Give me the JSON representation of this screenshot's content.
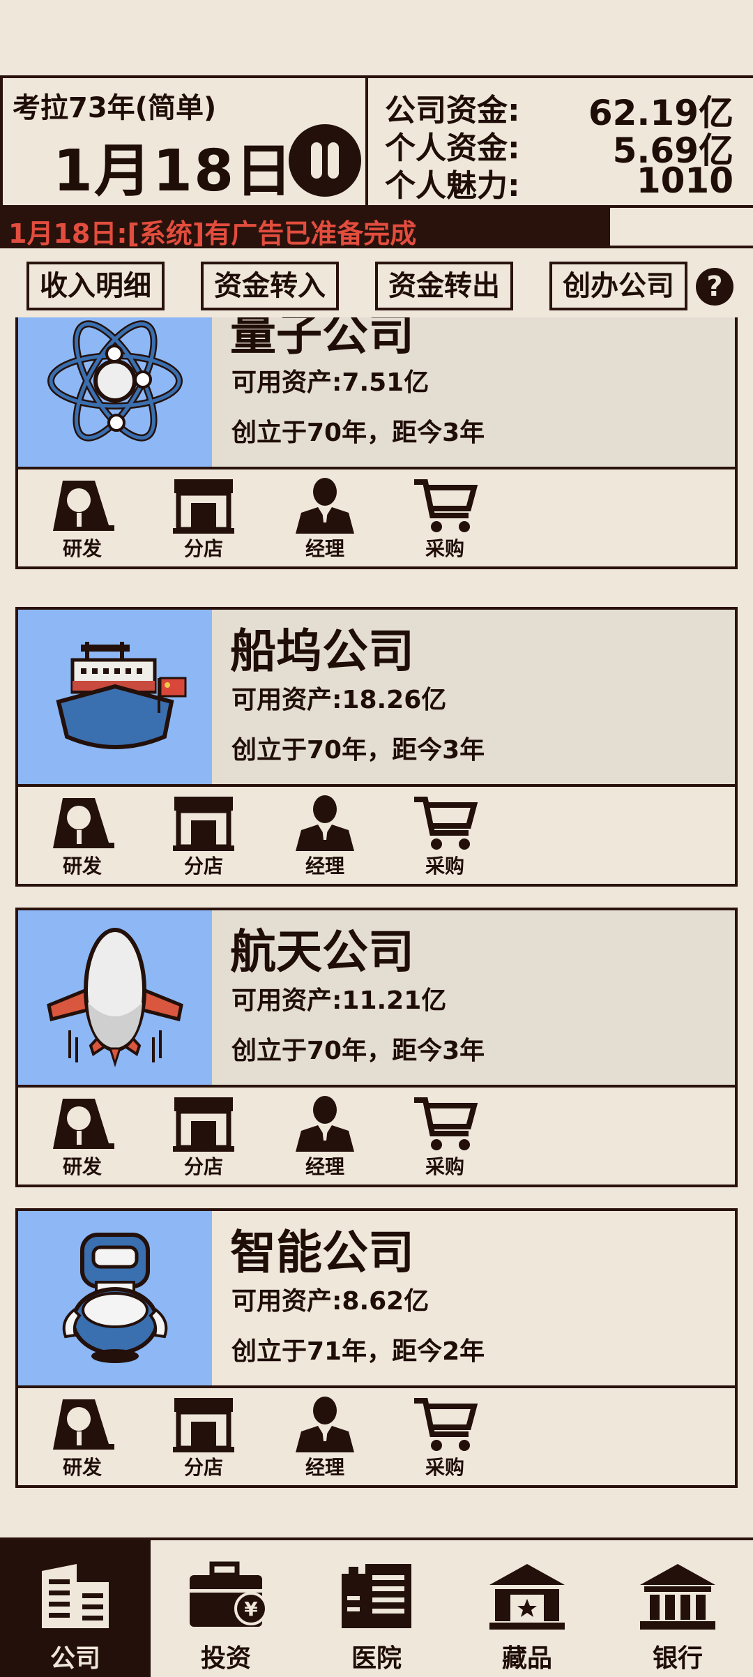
{
  "header": {
    "era": "考拉73年(简单)",
    "date": "1月18日",
    "finance": [
      {
        "label": "公司资金:",
        "value": "62.19亿"
      },
      {
        "label": "个人资金:",
        "value": "5.69亿"
      },
      {
        "label": "个人魅力:",
        "value": "1010"
      }
    ]
  },
  "ticker": "1月18日:[系统]有广告已准备完成",
  "actions": {
    "income_detail": "收入明细",
    "transfer_in": "资金转入",
    "transfer_out": "资金转出",
    "create_company": "创办公司",
    "help": "?"
  },
  "companies": [
    {
      "name": "量子公司",
      "assets": "可用资产:7.51亿",
      "founded": "创立于70年，距今3年",
      "icon": "atom-icon"
    },
    {
      "name": "船坞公司",
      "assets": "可用资产:18.26亿",
      "founded": "创立于70年，距今3年",
      "icon": "ship-icon"
    },
    {
      "name": "航天公司",
      "assets": "可用资产:11.21亿",
      "founded": "创立于70年，距今3年",
      "icon": "plane-icon"
    },
    {
      "name": "智能公司",
      "assets": "可用资产:8.62亿",
      "founded": "创立于71年，距今2年",
      "icon": "robot-icon"
    }
  ],
  "company_actions": {
    "research": "研发",
    "branch": "分店",
    "manager": "经理",
    "purchase": "采购"
  },
  "nav": [
    {
      "label": "公司",
      "icon": "company-icon",
      "active": true
    },
    {
      "label": "投资",
      "icon": "investment-icon"
    },
    {
      "label": "医院",
      "icon": "hospital-icon"
    },
    {
      "label": "藏品",
      "icon": "collection-icon"
    },
    {
      "label": "银行",
      "icon": "bank-icon"
    }
  ],
  "colors": {
    "background": "#efe7da",
    "dark": "#23100a",
    "ticker_text": "#e24d3e",
    "logo_bg": "#8db8f5"
  }
}
